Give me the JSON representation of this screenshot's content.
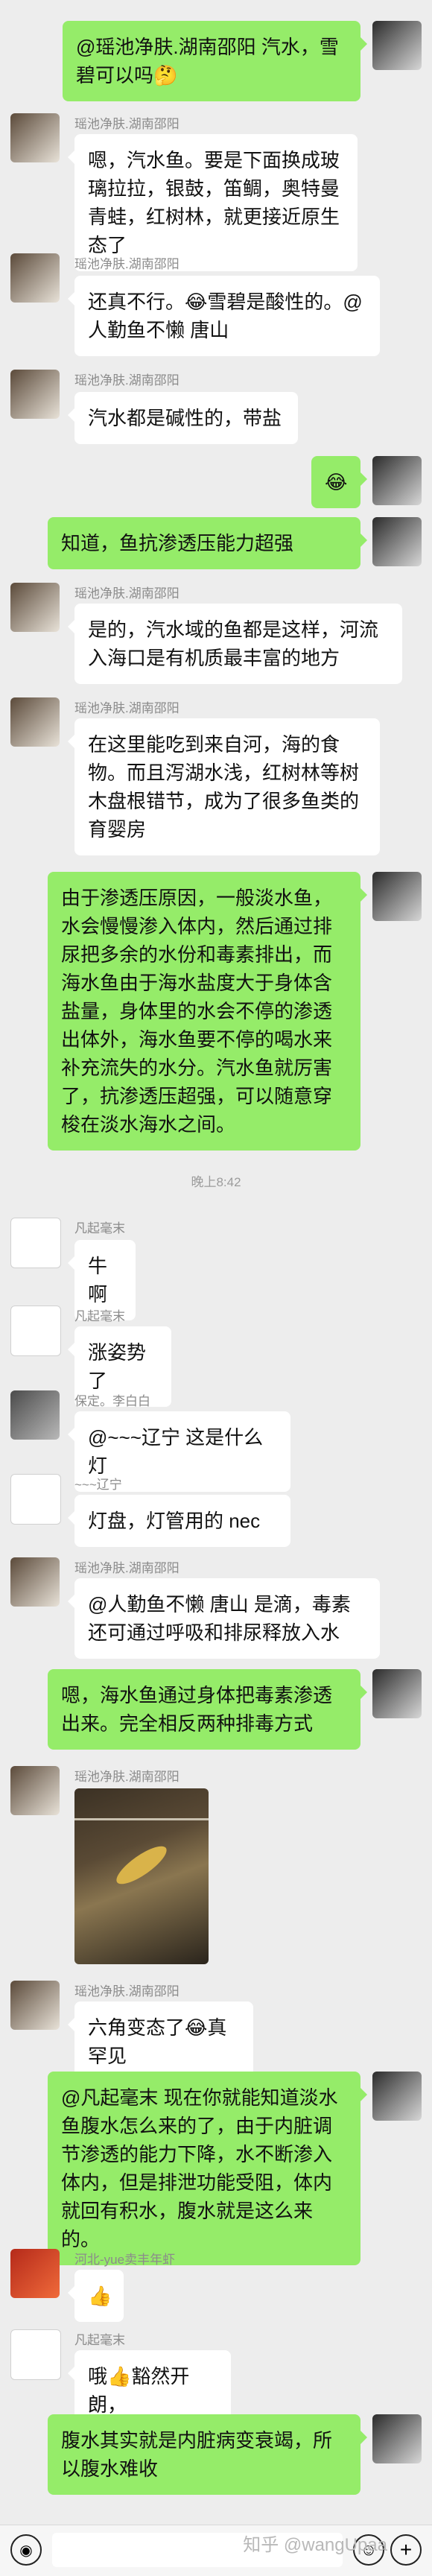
{
  "messages": [
    {
      "side": "right",
      "text": "@瑶池净肤.湖南邵阳  汽水，雪碧可以吗🤔"
    },
    {
      "side": "left",
      "sender": "瑶池净肤.湖南邵阳",
      "text": "嗯，汽水鱼。要是下面换成玻璃拉拉，银鼓，笛鲷，奥特曼青蛙，红树林，就更接近原生态了"
    },
    {
      "side": "left",
      "sender": "瑶池净肤.湖南邵阳",
      "text": "还真不行。😂雪碧是酸性的。@人勤鱼不懒 唐山"
    },
    {
      "side": "left",
      "sender": "瑶池净肤.湖南邵阳",
      "text": "汽水都是碱性的，带盐"
    },
    {
      "side": "right",
      "text": "😂"
    },
    {
      "side": "right",
      "text": "知道，鱼抗渗透压能力超强"
    },
    {
      "side": "left",
      "sender": "瑶池净肤.湖南邵阳",
      "text": "是的，汽水域的鱼都是这样，河流入海口是有机质最丰富的地方"
    },
    {
      "side": "left",
      "sender": "瑶池净肤.湖南邵阳",
      "text": "在这里能吃到来自河，海的食物。而且泻湖水浅，红树林等树木盘根错节，成为了很多鱼类的育婴房"
    },
    {
      "side": "right",
      "text": "由于渗透压原因，一般淡水鱼，水会慢慢渗入体内，然后通过排尿把多余的水份和毒素排出，而海水鱼由于海水盐度大于身体含盐量，身体里的水会不停的渗透出体外，海水鱼要不停的喝水来补充流失的水分。汽水鱼就厉害了，抗渗透压超强，可以随意穿梭在淡水海水之间。"
    },
    {
      "time": "晚上8:42"
    },
    {
      "side": "left",
      "sender": "凡起毫末",
      "text": "牛啊"
    },
    {
      "side": "left",
      "sender": "凡起毫末",
      "text": "涨姿势了"
    },
    {
      "side": "left",
      "sender": "保定。李白白",
      "text": "@~~~辽宁 这是什么灯"
    },
    {
      "side": "left",
      "sender": "~~~辽宁",
      "text": "灯盘，灯管用的 nec"
    },
    {
      "side": "left",
      "sender": "瑶池净肤.湖南邵阳",
      "text": "@人勤鱼不懒 唐山 是滴，毒素还可通过呼吸和排尿释放入水"
    },
    {
      "side": "right",
      "text": "嗯，海水鱼通过身体把毒素渗透出来。完全相反两种排毒方式"
    },
    {
      "side": "left",
      "sender": "瑶池净肤.湖南邵阳",
      "image": true
    },
    {
      "side": "left",
      "sender": "瑶池净肤.湖南邵阳",
      "text": "六角变态了😂真罕见"
    },
    {
      "side": "right",
      "text": "@凡起毫末  现在你就能知道淡水鱼腹水怎么来的了，由于内脏调节渗透的能力下降，水不断渗入体内，但是排泄功能受阻，体内就回有积水，腹水就是这么来的。"
    },
    {
      "side": "left",
      "sender": "河北-yue卖丰年虾",
      "text": "👍"
    },
    {
      "side": "left",
      "sender": "凡起毫末",
      "text": "哦👍豁然开朗，"
    },
    {
      "side": "right",
      "text": "腹水其实就是内脏病变衰竭，所以腹水难收"
    }
  ],
  "watermark": "知乎 @wangUpaa",
  "toolbar": {
    "voice_icon": "voice-icon",
    "emoji_icon": "emoji-icon",
    "plus_icon": "plus-icon"
  }
}
